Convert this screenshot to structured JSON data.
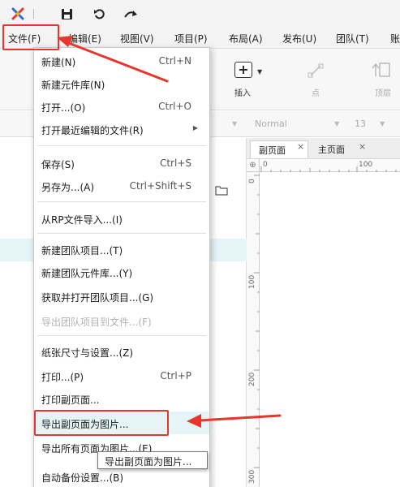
{
  "menubar": {
    "items": [
      "文件(F)",
      "编辑(E)",
      "视图(V)",
      "项目(P)",
      "布局(A)",
      "发布(U)",
      "团队(T)",
      "账"
    ]
  },
  "ribbon": {
    "insert_label": "插入",
    "point_label": "点",
    "top_label": "顶层"
  },
  "format_bar": {
    "font_style": "Normal",
    "font_size": "13"
  },
  "tabs": [
    {
      "label": "副页面",
      "close": "×"
    },
    {
      "label": "主页面",
      "close": "×"
    }
  ],
  "ruler": {
    "h_labels": [
      "0",
      "100"
    ],
    "v_labels": [
      "0",
      "100",
      "200",
      "300"
    ]
  },
  "file_menu": {
    "items": [
      {
        "label": "新建(N)",
        "shortcut": "Ctrl+N"
      },
      {
        "label": "新建元件库(N)",
        "shortcut": ""
      },
      {
        "label": "打开...(O)",
        "shortcut": "Ctrl+O"
      },
      {
        "label": "打开最近编辑的文件(R)",
        "shortcut": ""
      },
      {
        "label": "保存(S)",
        "shortcut": "Ctrl+S"
      },
      {
        "label": "另存为...(A)",
        "shortcut": "Ctrl+Shift+S"
      },
      {
        "label": "从RP文件导入...(I)",
        "shortcut": ""
      },
      {
        "label": "新建团队项目...(T)",
        "shortcut": ""
      },
      {
        "label": "新建团队元件库...(Y)",
        "shortcut": ""
      },
      {
        "label": "获取并打开团队项目...(G)",
        "shortcut": ""
      },
      {
        "label": "导出团队项目到文件...(F)",
        "shortcut": ""
      },
      {
        "label": "纸张尺寸与设置...(Z)",
        "shortcut": ""
      },
      {
        "label": "打印...(P)",
        "shortcut": "Ctrl+P"
      },
      {
        "label": "打印副页面...",
        "shortcut": ""
      },
      {
        "label": "导出副页面为图片...",
        "shortcut": ""
      },
      {
        "label": "导出所有页面为图片...(E)",
        "shortcut": ""
      },
      {
        "label": "自动备份设置...(B)",
        "shortcut": ""
      }
    ]
  },
  "tooltip": "导出副页面为图片...",
  "colors": {
    "annotation_red": "#e8362d",
    "highlight": "#e5f4f7"
  }
}
